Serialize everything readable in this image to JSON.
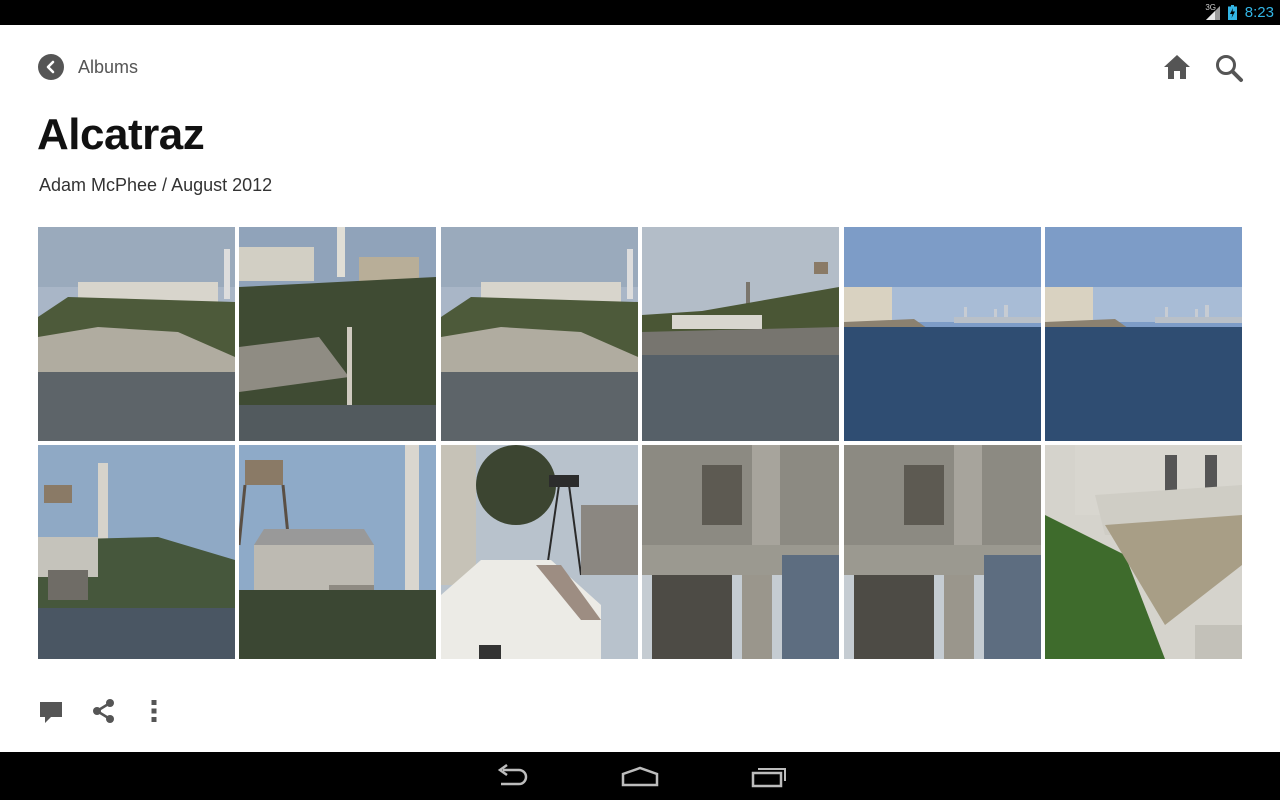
{
  "status_bar": {
    "network": "3G",
    "time": "8:23",
    "clock_color": "#33b5e5"
  },
  "header": {
    "back_label": "Albums"
  },
  "album": {
    "title": "Alcatraz",
    "subtitle": "Adam McPhee / August 2012"
  },
  "photos": [
    {
      "scene": "island-cliff-lighthouse"
    },
    {
      "scene": "cellhouse-cliff-closeup"
    },
    {
      "scene": "island-cliff-lighthouse"
    },
    {
      "scene": "island-water-tower"
    },
    {
      "scene": "bay-city-skyline"
    },
    {
      "scene": "bay-city-skyline"
    },
    {
      "scene": "water-tower-smokestack"
    },
    {
      "scene": "water-tower-building"
    },
    {
      "scene": "guard-tower-building"
    },
    {
      "scene": "ruined-building"
    },
    {
      "scene": "ruined-building"
    },
    {
      "scene": "cellhouse-stairs"
    }
  ],
  "actions": {
    "comment_icon": "comment-icon",
    "share_icon": "share-icon",
    "more_icon": "more-vert-icon"
  },
  "nav": {
    "back_icon": "nav-back-icon",
    "home_icon": "nav-home-icon",
    "recent_icon": "nav-recent-apps-icon"
  }
}
